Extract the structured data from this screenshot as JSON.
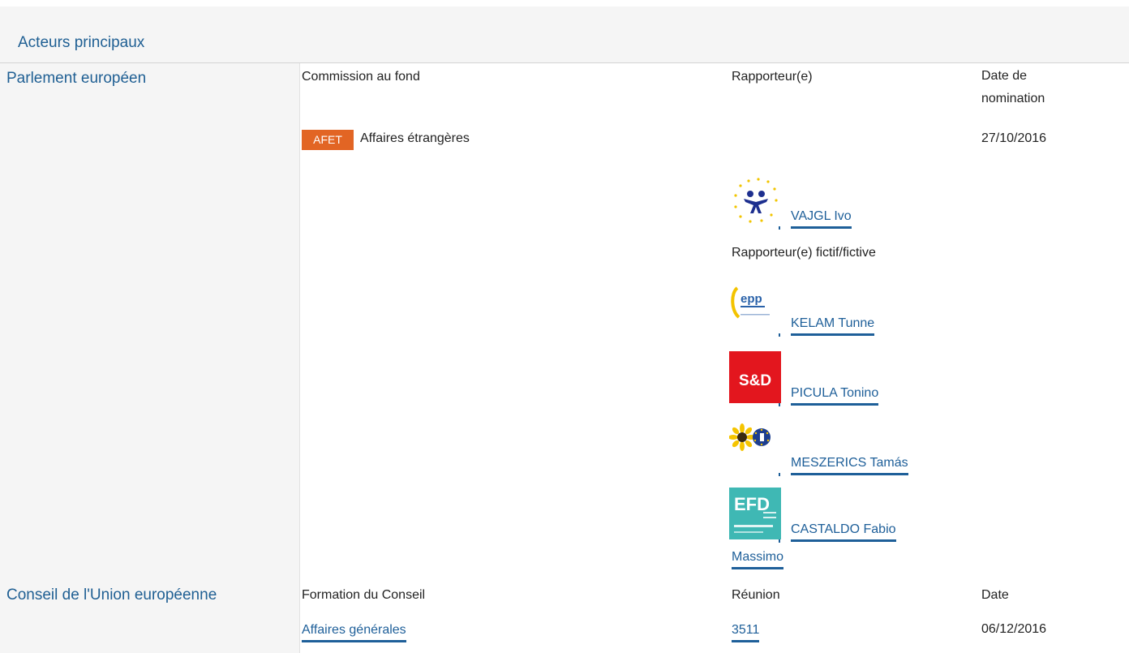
{
  "header": {
    "title": "Acteurs principaux"
  },
  "parliament": {
    "label": "Parlement européen",
    "columns": {
      "committee": "Commission au fond",
      "rapporteur": "Rapporteur(e)",
      "date": "Date de nomination"
    },
    "committee": {
      "badge": "AFET",
      "name": "Affaires étrangères",
      "date": "27/10/2016"
    },
    "rapporteur": {
      "name": "VAJGL Ivo",
      "group_icon": "alde-logo-icon"
    },
    "shadow_label": "Rapporteur(e) fictif/fictive",
    "shadows": [
      {
        "name": "KELAM Tunne",
        "group_icon": "epp-logo-icon",
        "logo_text": "epp"
      },
      {
        "name": "PICULA Tonino",
        "group_icon": "sd-logo-icon",
        "logo_text": "S&D"
      },
      {
        "name": "MESZERICS Tamás",
        "group_icon": "greens-efa-logo-icon"
      },
      {
        "name_line1": "CASTALDO Fabio",
        "name_line2": "Massimo",
        "group_icon": "efdd-logo-icon",
        "logo_text": "EFD"
      }
    ],
    "colors": {
      "sd": "#e3161e",
      "efdd": "#3fb8b4",
      "epp": "#2a62a9"
    }
  },
  "council": {
    "label": "Conseil de l'Union européenne",
    "columns": {
      "formation": "Formation du Conseil",
      "meeting": "Réunion",
      "date": "Date"
    },
    "row": {
      "formation": "Affaires générales",
      "meeting": "3511",
      "date": "06/12/2016"
    }
  },
  "colors": {
    "link": "#1e5f99",
    "heading": "#1f5f93",
    "badge": "#e26524",
    "panel": "#f5f5f5"
  }
}
